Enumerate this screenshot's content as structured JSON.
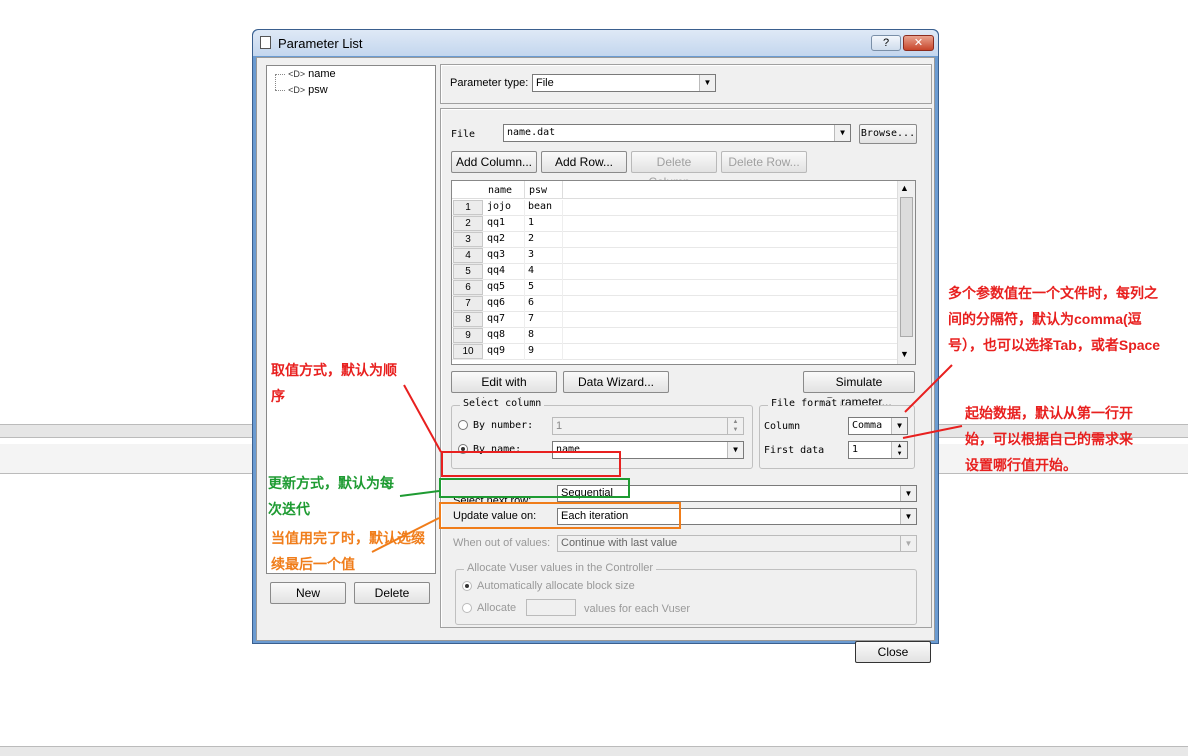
{
  "dialog": {
    "title": "Parameter List",
    "help_label": "?",
    "close_label": "✕"
  },
  "tree": {
    "items": [
      {
        "label": "name"
      },
      {
        "label": "psw"
      }
    ]
  },
  "left_buttons": {
    "new_label": "New",
    "delete_label": "Delete"
  },
  "param_type": {
    "label": "Parameter type:",
    "value": "File"
  },
  "file": {
    "label": "File",
    "value": "name.dat",
    "browse_label": "Browse..."
  },
  "grid_buttons": {
    "add_column": "Add Column...",
    "add_row": "Add Row...",
    "delete_column": "Delete Column...",
    "delete_row": "Delete Row..."
  },
  "table": {
    "columns": [
      "name",
      "psw"
    ],
    "rows": [
      {
        "n": "1",
        "name": "jojo",
        "psw": "bean"
      },
      {
        "n": "2",
        "name": "qq1",
        "psw": "1"
      },
      {
        "n": "3",
        "name": "qq2",
        "psw": "2"
      },
      {
        "n": "4",
        "name": "qq3",
        "psw": "3"
      },
      {
        "n": "5",
        "name": "qq4",
        "psw": "4"
      },
      {
        "n": "6",
        "name": "qq5",
        "psw": "5"
      },
      {
        "n": "7",
        "name": "qq6",
        "psw": "6"
      },
      {
        "n": "8",
        "name": "qq7",
        "psw": "7"
      },
      {
        "n": "9",
        "name": "qq8",
        "psw": "8"
      },
      {
        "n": "10",
        "name": "qq9",
        "psw": "9"
      }
    ]
  },
  "lower_buttons": {
    "edit_notepad": "Edit with Notepad...",
    "data_wizard": "Data Wizard...",
    "simulate": "Simulate Parameter..."
  },
  "select_column": {
    "title": "Select column",
    "by_number_label": "By number:",
    "by_number_value": "1",
    "by_name_label": "By name:",
    "by_name_value": "name"
  },
  "file_format": {
    "title": "File format",
    "column_label": "Column",
    "column_value": "Comma",
    "first_data_label": "First data",
    "first_data_value": "1"
  },
  "next_row": {
    "label": "Select next row:",
    "value": "Sequential"
  },
  "update_value": {
    "label": "Update value on:",
    "value": "Each iteration"
  },
  "out_of_values": {
    "label": "When out of values:",
    "value": "Continue with last value"
  },
  "allocate": {
    "title": "Allocate Vuser values in the Controller",
    "auto_label": "Automatically allocate block size",
    "allocate_label": "Allocate",
    "allocate_suffix": "values for each Vuser"
  },
  "close_button": "Close",
  "annotations": {
    "select_mode_line1": "取值方式，默认为顺",
    "select_mode_line2": "序",
    "update_line1": "更新方式，默认为每",
    "update_line2": "次迭代",
    "out_line1": "当值用完了时，默认选缀",
    "out_line2": "续最后一个值",
    "delimiter_line1": "多个参数值在一个文件时，每列之",
    "delimiter_line2": "间的分隔符，默认为comma(逗",
    "delimiter_line3": "号），也可以选择Tab，或者Space",
    "first_data_line1": "起始数据，默认从第一行开",
    "first_data_line2": "始，可以根据自己的需求来",
    "first_data_line3": "设置哪行值开始。"
  },
  "colors": {
    "red": "#e8201f",
    "green": "#1e9b32",
    "orange": "#f07d1a",
    "title_blue": "#6b9bd1"
  }
}
